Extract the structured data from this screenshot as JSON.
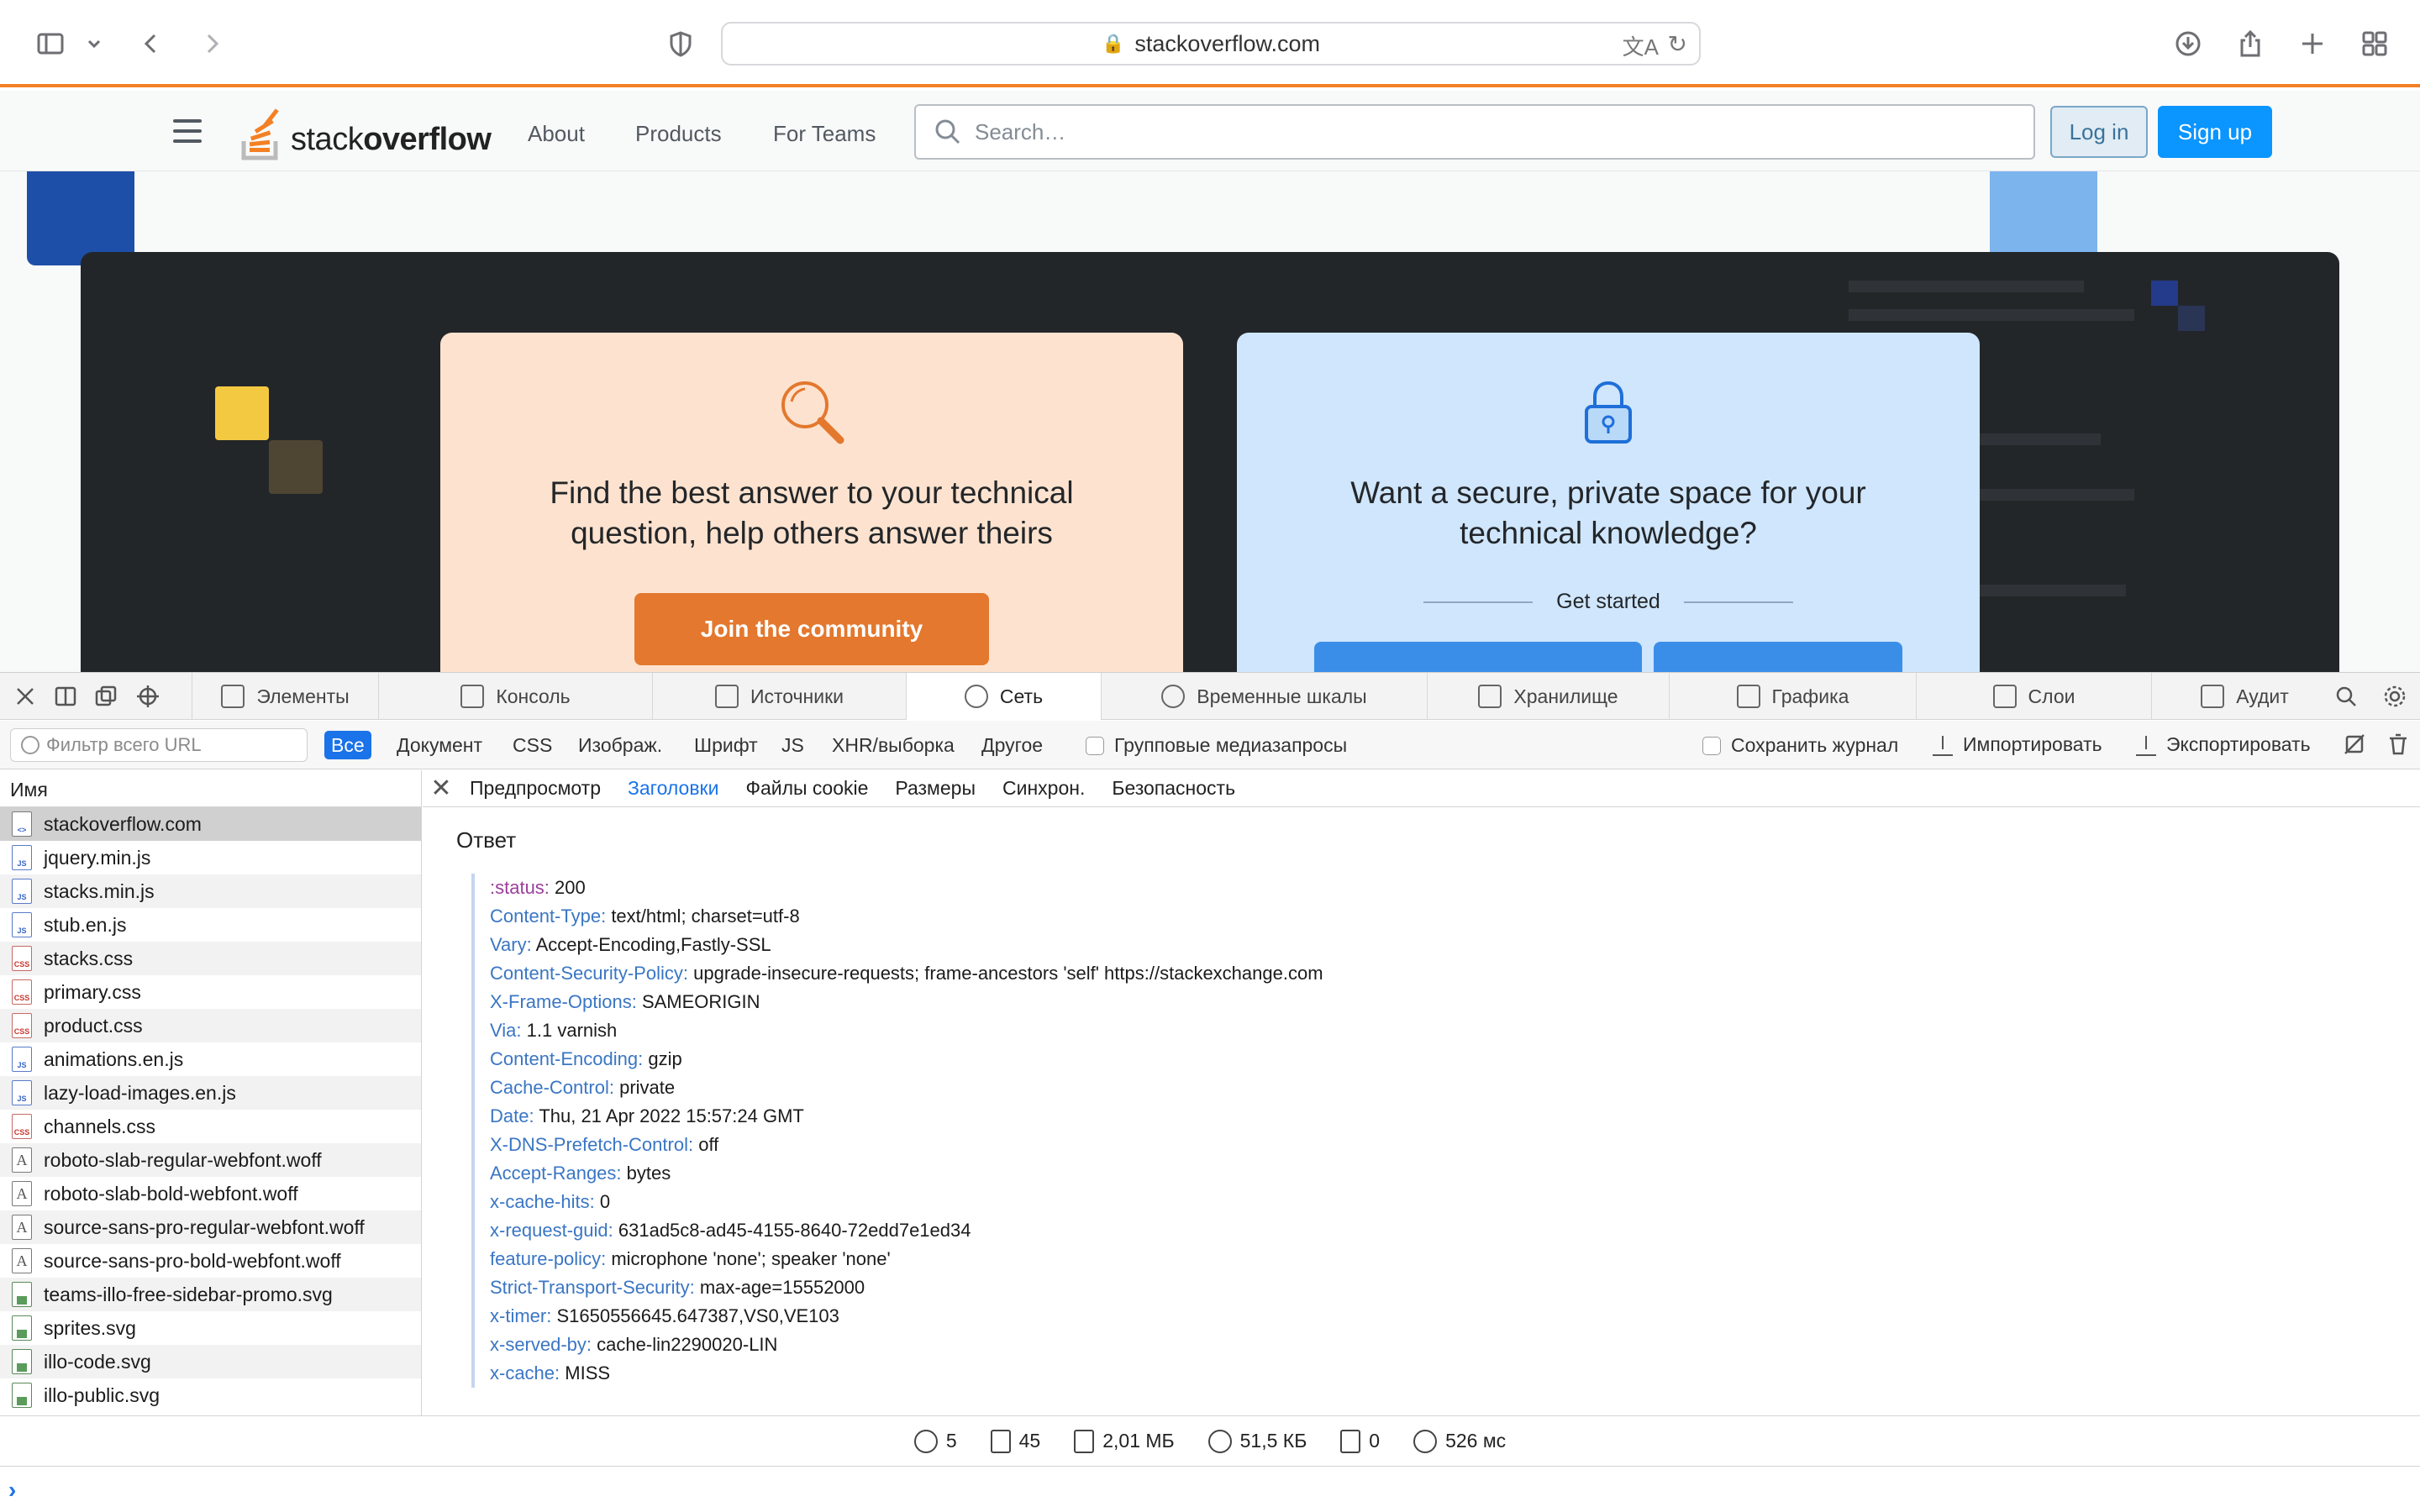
{
  "browser": {
    "url": "stackoverflow.com"
  },
  "so_header": {
    "logo_text_light": "stack",
    "logo_text_bold": "overflow",
    "nav": [
      "About",
      "Products",
      "For Teams"
    ],
    "search_placeholder": "Search…",
    "login": "Log in",
    "signup": "Sign up",
    "brand_color": "#f48024"
  },
  "hero": {
    "community_card": {
      "line1": "Find the best answer to your technical",
      "line2": "question, help others answer theirs",
      "button": "Join the community"
    },
    "teams_card": {
      "line1": "Want a secure, private space for your",
      "line2": "technical knowledge?",
      "get_started": "Get started"
    }
  },
  "devtools": {
    "tabs": [
      "Элементы",
      "Консоль",
      "Источники",
      "Сеть",
      "Временные шкалы",
      "Хранилище",
      "Графика",
      "Слои",
      "Аудит"
    ],
    "active_tab": "Сеть",
    "filter_placeholder": "Фильтр всего URL",
    "filter_types": [
      "Все",
      "Документ",
      "CSS",
      "Изображ.",
      "Шрифт",
      "JS",
      "XHR/выборка",
      "Другое"
    ],
    "group_media": "Групповые медиазапросы",
    "preserve_log": "Сохранить журнал",
    "import": "Импортировать",
    "export": "Экспортировать",
    "name_header": "Имя",
    "files": [
      {
        "name": "stackoverflow.com",
        "type": "doc"
      },
      {
        "name": "jquery.min.js",
        "type": "js"
      },
      {
        "name": "stacks.min.js",
        "type": "js"
      },
      {
        "name": "stub.en.js",
        "type": "js"
      },
      {
        "name": "stacks.css",
        "type": "css"
      },
      {
        "name": "primary.css",
        "type": "css"
      },
      {
        "name": "product.css",
        "type": "css"
      },
      {
        "name": "animations.en.js",
        "type": "js"
      },
      {
        "name": "lazy-load-images.en.js",
        "type": "js"
      },
      {
        "name": "channels.css",
        "type": "css"
      },
      {
        "name": "roboto-slab-regular-webfont.woff",
        "type": "font"
      },
      {
        "name": "roboto-slab-bold-webfont.woff",
        "type": "font"
      },
      {
        "name": "source-sans-pro-regular-webfont.woff",
        "type": "font"
      },
      {
        "name": "source-sans-pro-bold-webfont.woff",
        "type": "font"
      },
      {
        "name": "teams-illo-free-sidebar-promo.svg",
        "type": "img"
      },
      {
        "name": "sprites.svg",
        "type": "img"
      },
      {
        "name": "illo-code.svg",
        "type": "img"
      },
      {
        "name": "illo-public.svg",
        "type": "img"
      }
    ],
    "detail_tabs": [
      "Предпросмотр",
      "Заголовки",
      "Файлы cookie",
      "Размеры",
      "Синхрон.",
      "Безопасность"
    ],
    "active_detail_tab": "Заголовки",
    "response_title": "Ответ",
    "headers": [
      {
        "k": ":status:",
        "v": "200"
      },
      {
        "k": "Content-Type:",
        "v": "text/html; charset=utf-8"
      },
      {
        "k": "Vary:",
        "v": "Accept-Encoding,Fastly-SSL"
      },
      {
        "k": "Content-Security-Policy:",
        "v": "upgrade-insecure-requests; frame-ancestors 'self' https://stackexchange.com"
      },
      {
        "k": "X-Frame-Options:",
        "v": "SAMEORIGIN"
      },
      {
        "k": "Via:",
        "v": "1.1 varnish"
      },
      {
        "k": "Content-Encoding:",
        "v": "gzip"
      },
      {
        "k": "Cache-Control:",
        "v": "private"
      },
      {
        "k": "Date:",
        "v": "Thu, 21 Apr 2022 15:57:24 GMT"
      },
      {
        "k": "X-DNS-Prefetch-Control:",
        "v": "off"
      },
      {
        "k": "Accept-Ranges:",
        "v": "bytes"
      },
      {
        "k": "x-cache-hits:",
        "v": "0"
      },
      {
        "k": "x-request-guid:",
        "v": "631ad5c8-ad45-4155-8640-72edd7e1ed34"
      },
      {
        "k": "feature-policy:",
        "v": "microphone 'none'; speaker 'none'"
      },
      {
        "k": "Strict-Transport-Security:",
        "v": "max-age=15552000"
      },
      {
        "k": "x-timer:",
        "v": "S1650556645.647387,VS0,VE103"
      },
      {
        "k": "x-served-by:",
        "v": "cache-lin2290020-LIN"
      },
      {
        "k": "x-cache:",
        "v": "MISS"
      }
    ],
    "status": {
      "domains": "5",
      "resources": "45",
      "size": "2,01 МБ",
      "transferred": "51,5 КБ",
      "upload": "0",
      "time": "526 мс"
    }
  }
}
